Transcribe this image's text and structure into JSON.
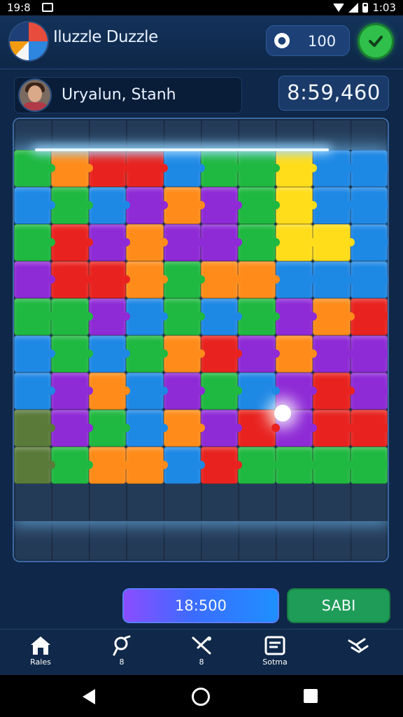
{
  "status_bar": {
    "time": "19:8",
    "clock": "1:03"
  },
  "header": {
    "title": "Iluzzle Duzzle",
    "coins": "100",
    "coin_icon": "coin-icon",
    "confirm_icon": "check-icon"
  },
  "player": {
    "name": "Uryalun, Stanh",
    "timer": "8:59,460"
  },
  "board": {
    "palette": {
      "G": "#1fb840",
      "O": "#ff8c1a",
      "R": "#e8231f",
      "B": "#1e88e5",
      "P": "#8e2ad6",
      "Y": "#ffdd1a",
      "K": "#5a7a3a",
      "_": "transparent"
    },
    "rows": [
      "GORRBGGYBB",
      "BGBPOPGYBB",
      "GRPOPPGYYB",
      "PRROGOOBBB",
      "GGPBGBGPOR",
      "BGBGORPOPP",
      "BPOBPGBPRP",
      "KPGBOPRPRR",
      "KGOOBRGGGG",
      "____ _____"
    ]
  },
  "actions": {
    "score": "18:500",
    "save": "SABI"
  },
  "nav": [
    {
      "label": "Rales",
      "icon": "home-icon"
    },
    {
      "label": "8",
      "icon": "pin-icon"
    },
    {
      "label": "8",
      "icon": "tools-icon"
    },
    {
      "label": "Sotma",
      "icon": "document-icon"
    },
    {
      "label": "",
      "icon": "handshake-icon"
    }
  ],
  "colors": {
    "accent": "#1e88e5",
    "confirm": "#2fbf4a",
    "save": "#1f9c57",
    "score_from": "#8b4dff",
    "score_to": "#1e90ff"
  }
}
